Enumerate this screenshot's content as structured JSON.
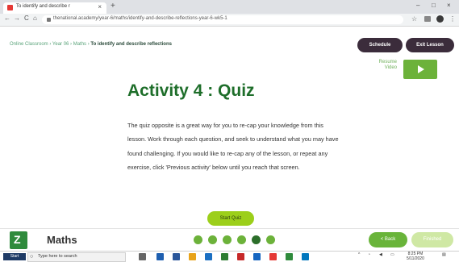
{
  "browser": {
    "tab_title": "To identify and describe r",
    "tab_close": "×",
    "new_tab": "+",
    "win_min": "–",
    "win_max": "□",
    "win_close": "×",
    "url": "thenational.academy/year-6/maths/identify-and-describe-reflections-year-6-wk5-1",
    "back": "←",
    "forward": "→",
    "reload": "C",
    "home": "⌂",
    "star": "☆",
    "menu": "⋮"
  },
  "breadcrumb": {
    "trail": "Online Classroom › Year 06 › Maths › ",
    "current": "To identify and describe reflections"
  },
  "header_buttons": {
    "schedule": "Schedule",
    "exit": "Exit Lesson"
  },
  "resume_video": {
    "label_line1": "Resume",
    "label_line2": "Video"
  },
  "main": {
    "title": "Activity 4 : Quiz",
    "body": "The quiz opposite is a great way for you to re-cap your knowledge from this lesson. Work through each question, and seek to understand what you may have found challenging. If you would like to re-cap any of the lesson, or repeat any exercise, click 'Previous activity' below until you reach that screen.",
    "start_label": "Start Quiz"
  },
  "footer": {
    "subject": "Maths",
    "subject_icon": "Z",
    "progress": {
      "total": 6,
      "current": 5
    },
    "back_label": "< Back",
    "finished_label": "Finished"
  },
  "taskbar": {
    "start": "Start",
    "search_placeholder": "Type here to search",
    "time": "8:25 PM",
    "date": "5/11/2020"
  },
  "colors": {
    "brand_green": "#6cb23a",
    "title_green": "#1e6e2a",
    "dark_button": "#3b2c3b",
    "quiz_button": "#9ccf1a",
    "active_dot": "#2c6e2a"
  }
}
